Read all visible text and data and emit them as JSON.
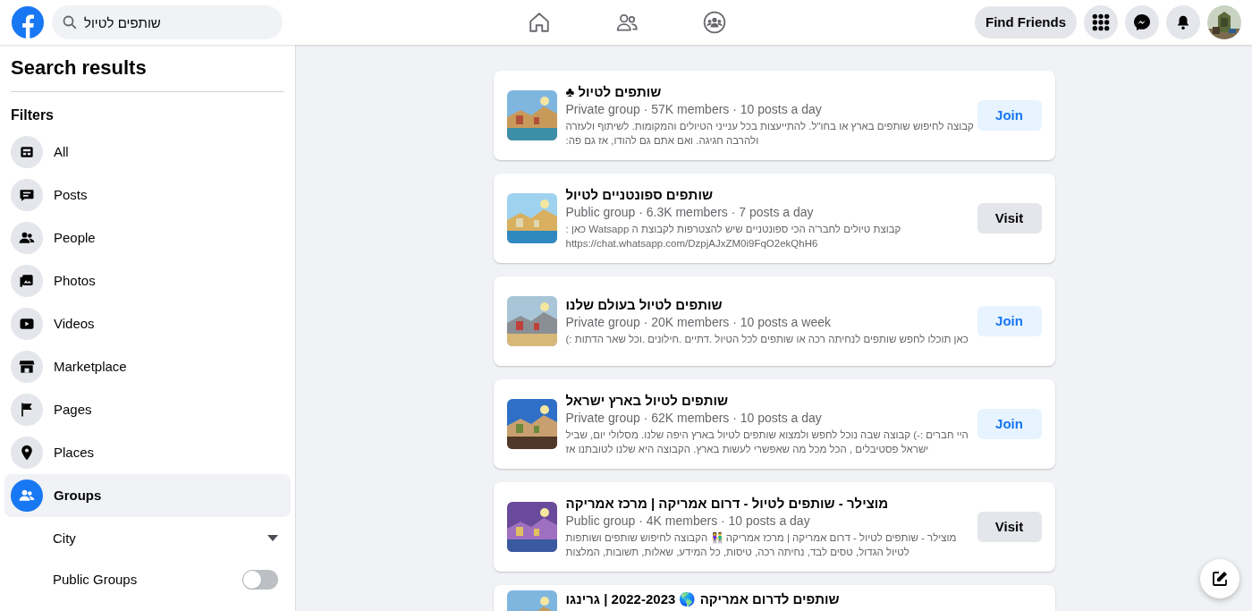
{
  "top_bar": {
    "search": {
      "value": "שותפים לטיול"
    },
    "find_friends": "Find Friends"
  },
  "sidebar": {
    "title": "Search results",
    "filters_label": "Filters",
    "items": [
      {
        "label": "All",
        "selected": false
      },
      {
        "label": "Posts",
        "selected": false
      },
      {
        "label": "People",
        "selected": false
      },
      {
        "label": "Photos",
        "selected": false
      },
      {
        "label": "Videos",
        "selected": false
      },
      {
        "label": "Marketplace",
        "selected": false
      },
      {
        "label": "Pages",
        "selected": false
      },
      {
        "label": "Places",
        "selected": false
      },
      {
        "label": "Groups",
        "selected": true
      }
    ],
    "group_options": [
      {
        "kind": "dropdown",
        "label": "City"
      },
      {
        "kind": "toggle",
        "label": "Public Groups",
        "on": false
      }
    ]
  },
  "results": [
    {
      "title": "שותפים לטיול ♣",
      "meta": "Private group · 57K members · 10 posts a day",
      "description": "קבוצה לחיפוש שותפים בארץ או בחו\"ל. להתייעצות בכל ענייני הטיולים והמקומות. לשיתוף ולעזרה ולהרבה חגיגה. ואם אתם גם להודו, אז גם פה:",
      "action": "Join",
      "kind": "join"
    },
    {
      "title": "שותפים ספונטניים לטיול",
      "meta": "Public group · 6.3K members · 7 posts a day",
      "description": "קבוצת טיולים לחבר'ה הכי ספונטניים שיש להצטרפות לקבוצת ה Watsapp כאן : https://chat.whatsapp.com/DzpjAJxZM0i9FqO2ekQhH6",
      "action": "Visit",
      "kind": "visit"
    },
    {
      "title": "שותפים לטיול בעולם שלנו",
      "meta": "Private group · 20K members · 10 posts a week",
      "description": "כאן תוכלו לחפש שותפים לנחיתה רכה או שותפים לכל הטיול .דתיים .חילונים .וכל שאר הדתות :)",
      "action": "Join",
      "kind": "join"
    },
    {
      "title": "שותפים לטיול בארץ ישראל",
      "meta": "Private group · 62K members · 10 posts a day",
      "description": "היי חברים :-) קבוצה שבה נוכל לחפש ולמצוא שותפים לטיול בארץ היפה שלנו. מסלולי יום, שביל ישראל פסטיבלים , הכל מכל מה שאפשרי לעשות בארץ. הקבוצה היא שלנו לטובתנו אז",
      "action": "Join",
      "kind": "join"
    },
    {
      "title": "מוצילר - שותפים לטיול - דרום אמריקה | מרכז אמריקה",
      "meta": "Public group · 4K members · 10 posts a day",
      "description": "מוצילר - שותפים לטיול - דרום אמריקה | מרכז אמריקה 👫 הקבוצה לחיפוש שותפים ושותפות לטיול הגדול, טסים לבד, נחיתה רכה, טיסות, כל המידע, שאלות, תשובות, המלצות",
      "action": "Visit",
      "kind": "visit"
    },
    {
      "title": "שותפים לדרום אמריקה 🌎 2022-2023 | גרינגו",
      "kind": "partial"
    }
  ]
}
